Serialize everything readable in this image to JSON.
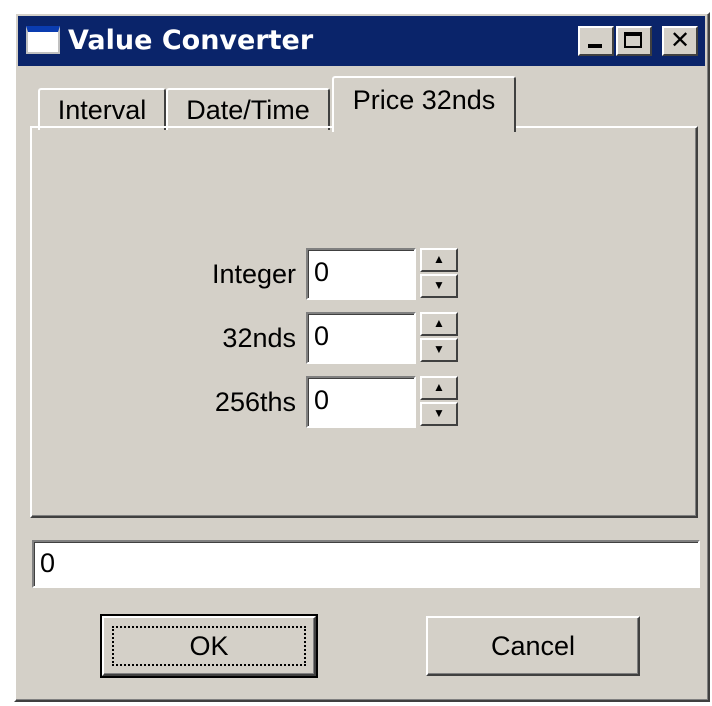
{
  "window": {
    "title": "Value Converter",
    "title_icon": "window-icon",
    "controls": {
      "minimize": "minimize-icon",
      "maximize": "maximize-icon",
      "close": "✕"
    }
  },
  "tabs": [
    {
      "label": "Interval",
      "active": false
    },
    {
      "label": "Date/Time",
      "active": false
    },
    {
      "label": "Price 32nds",
      "active": true
    }
  ],
  "fields": [
    {
      "label": "Integer",
      "value": "0"
    },
    {
      "label": "32nds",
      "value": "0"
    },
    {
      "label": "256ths",
      "value": "0"
    }
  ],
  "spin": {
    "up": "▲",
    "down": "▼"
  },
  "result": {
    "value": "0"
  },
  "buttons": {
    "ok": "OK",
    "cancel": "Cancel"
  },
  "colors": {
    "titlebar": "#0a246a",
    "face": "#d4d0c8"
  }
}
